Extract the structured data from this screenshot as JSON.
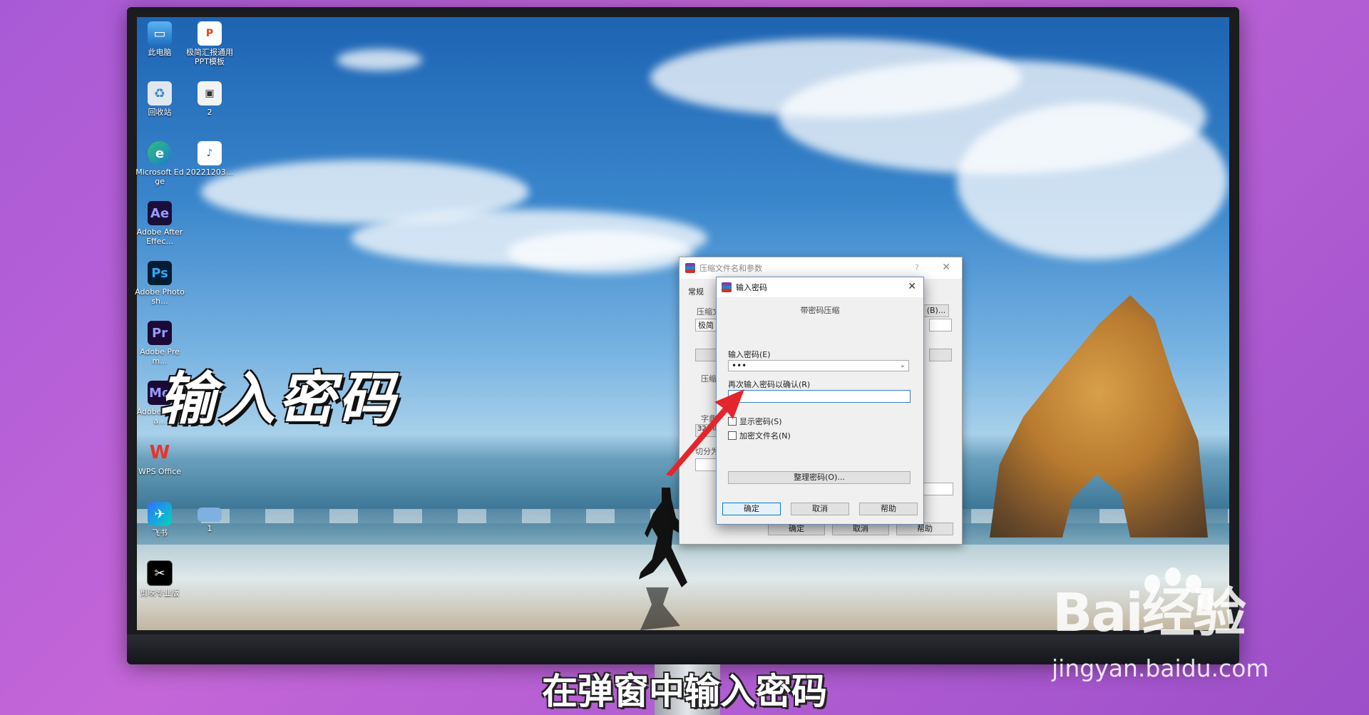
{
  "desktop_icons": [
    {
      "label": "此电脑",
      "icon": "computer-icon"
    },
    {
      "label": "极简汇报通用PPT模板",
      "icon": "ppt-file-icon"
    },
    {
      "label": "回收站",
      "icon": "recycle-bin-icon"
    },
    {
      "label": "2",
      "icon": "image-file-icon"
    },
    {
      "label": "Microsoft Edge",
      "icon": "edge-icon"
    },
    {
      "label": "20221203...",
      "icon": "audio-file-icon"
    },
    {
      "label": "Adobe After Effec...",
      "icon": "after-effects-icon",
      "glyph": "Ae"
    },
    {
      "label": "Adobe Photosh...",
      "icon": "photoshop-icon",
      "glyph": "Ps"
    },
    {
      "label": "Adobe Prem...",
      "icon": "premiere-icon",
      "glyph": "Pr"
    },
    {
      "label": "Adobe Media...",
      "icon": "media-encoder-icon",
      "glyph": "Me"
    },
    {
      "label": "WPS Office",
      "icon": "wps-icon",
      "glyph": "W"
    },
    {
      "label": "飞书",
      "icon": "feishu-icon"
    },
    {
      "label": "1",
      "icon": "image-file-icon"
    },
    {
      "label": "剪映专业版",
      "icon": "capcut-icon"
    }
  ],
  "back_dialog": {
    "title": "压缩文件名和参数",
    "help_glyph": "?",
    "tab_general": "常规",
    "label_archive": "压缩文",
    "archive_value": "极简",
    "browse_button": "(B)...",
    "label_compress": "压缩",
    "label_dict": "字典大",
    "dict_value": "32 MB",
    "label_split": "切分为",
    "ok": "确定",
    "cancel": "取消",
    "help": "帮助"
  },
  "password_dialog": {
    "title": "输入密码",
    "heading": "带密码压缩",
    "label_password": "输入密码(E)",
    "password_value": "•••",
    "label_confirm": "再次输入密码以确认(R)",
    "confirm_value": "",
    "check_show": "显示密码(S)",
    "check_encrypt_names": "加密文件名(N)",
    "organize_button": "整理密码(O)...",
    "ok": "确定",
    "cancel": "取消",
    "help": "帮助"
  },
  "overlay_title": "输入密码",
  "subtitle": "在弹窗中输入密码",
  "watermark": {
    "brand": "Bai经验",
    "site": "jingyan.baidu.com"
  }
}
